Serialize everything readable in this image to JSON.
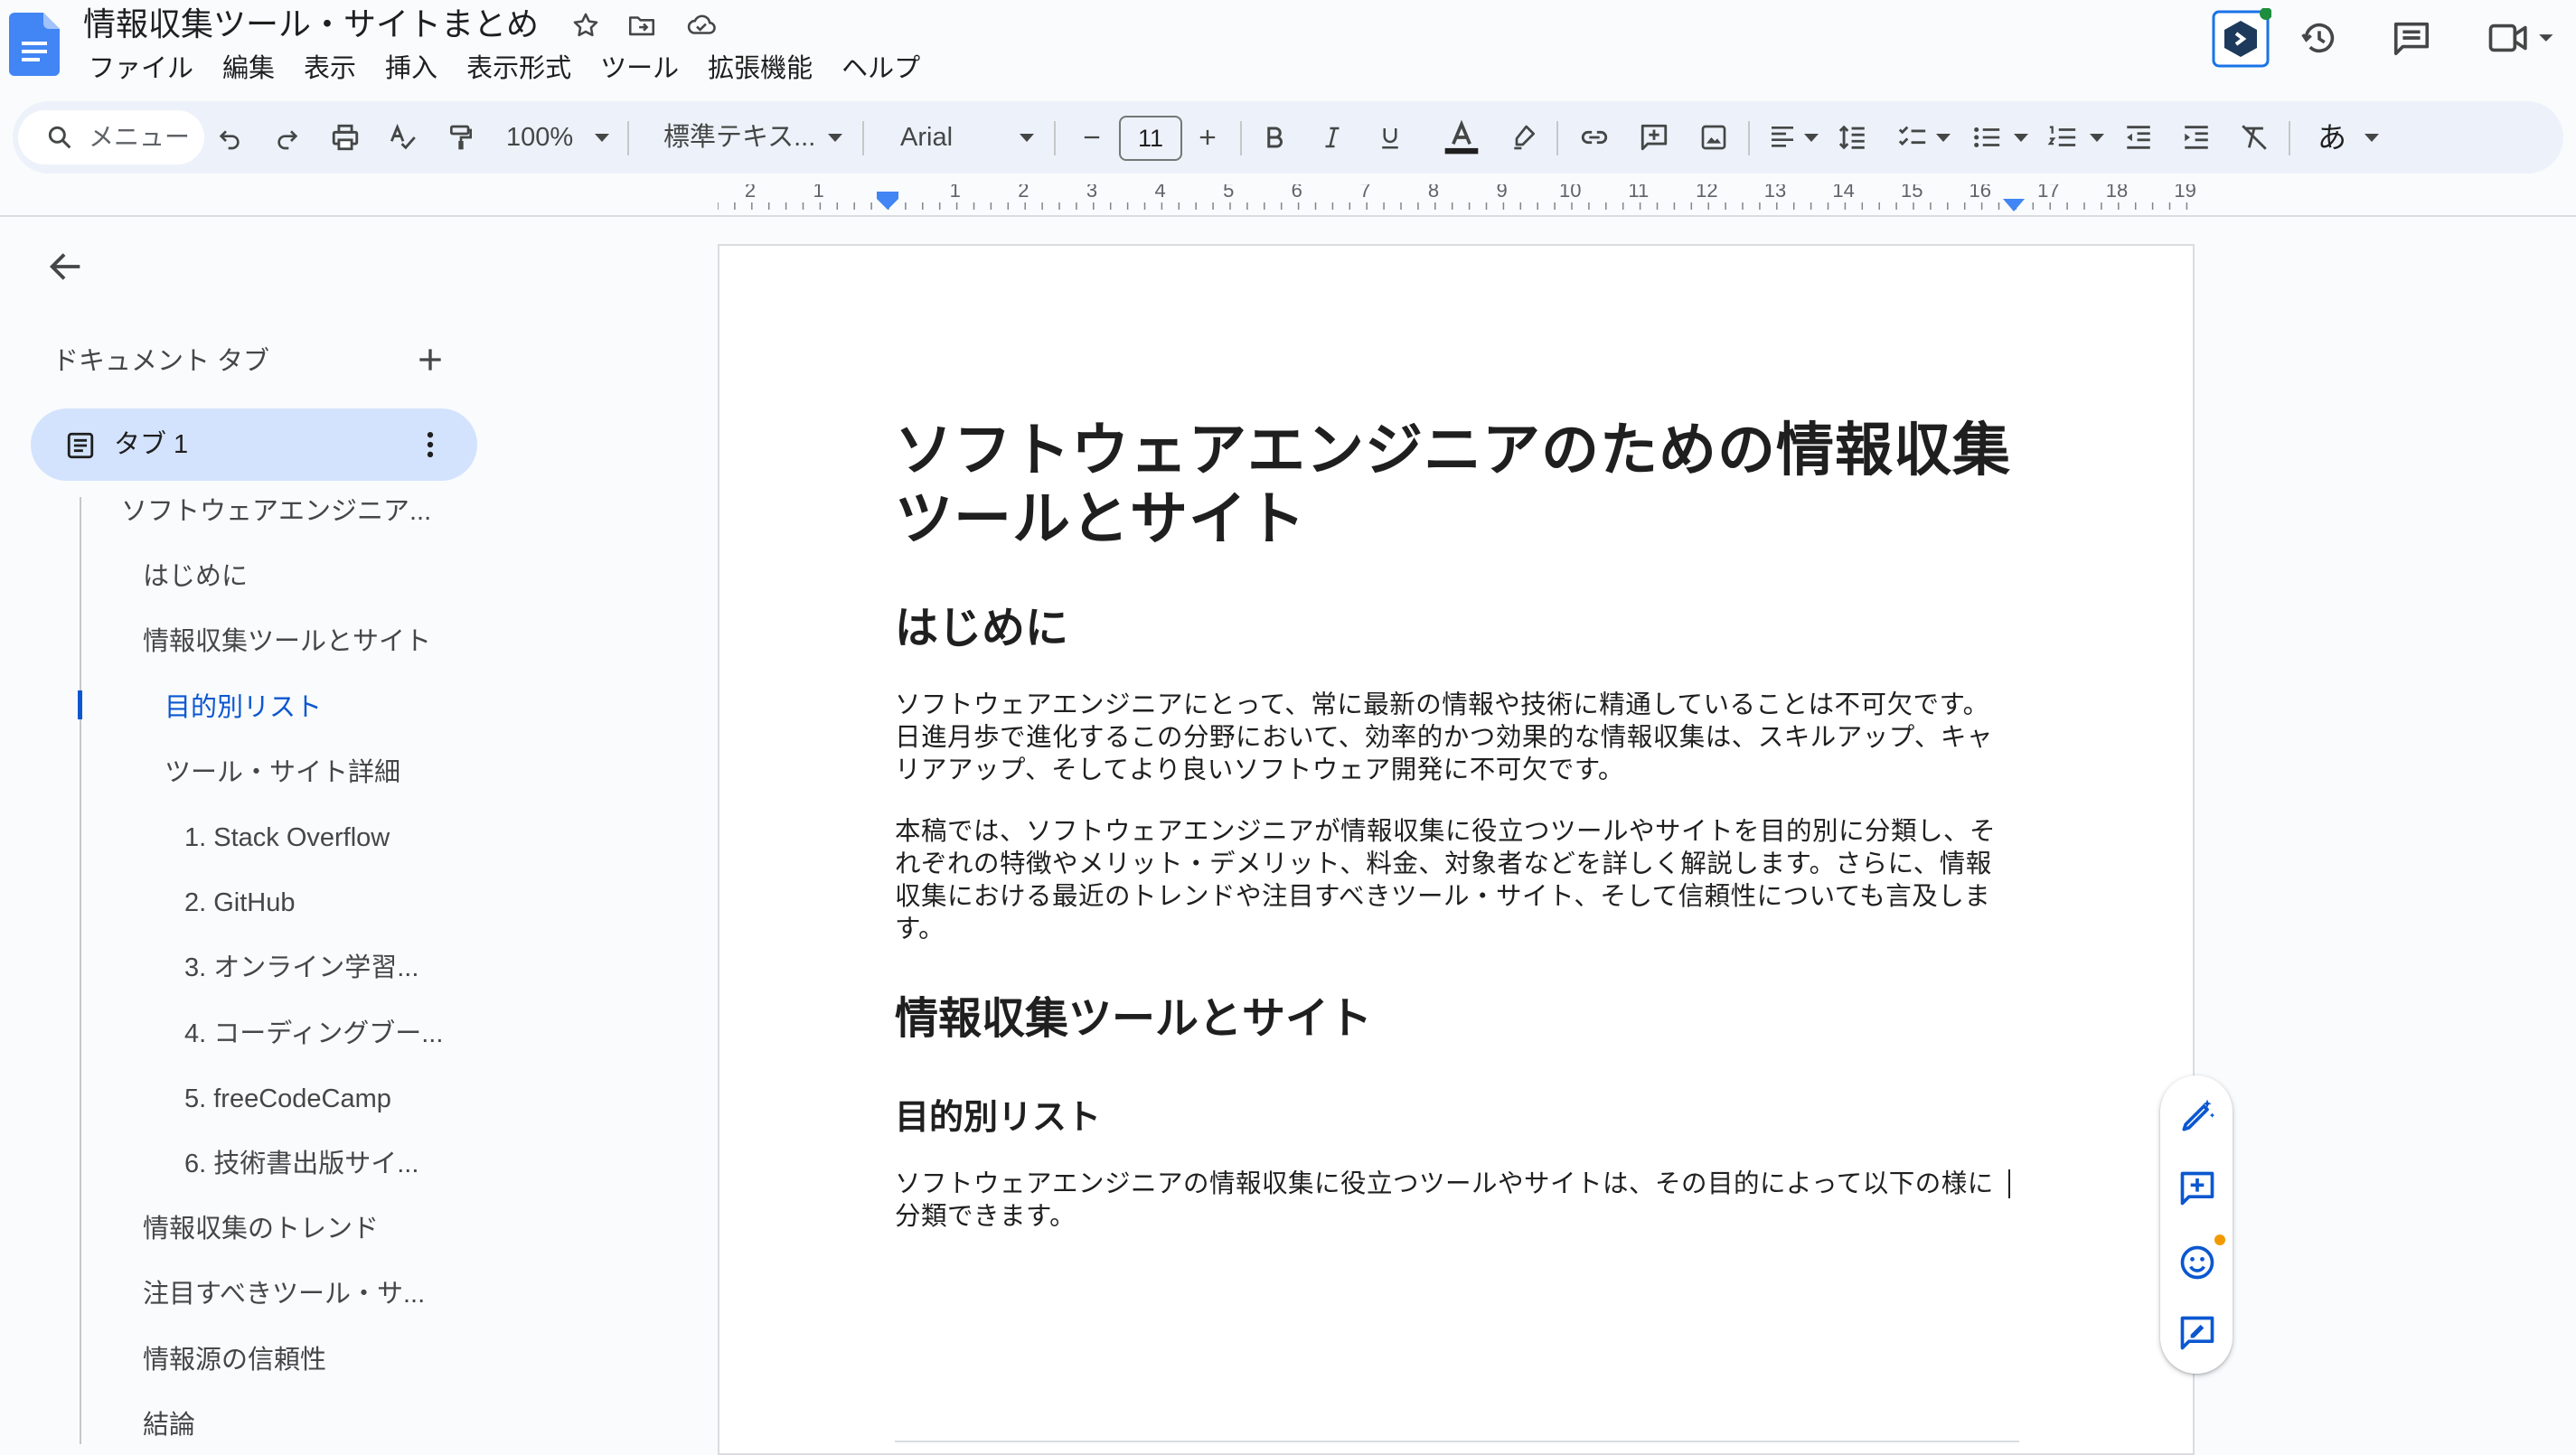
{
  "title_bar": {
    "document_title": "情報収集ツール・サイトまとめ",
    "star_icon": "star-icon",
    "move_icon": "folder-move-icon",
    "cloud_icon": "cloud-status-icon"
  },
  "menu": [
    "ファイル",
    "編集",
    "表示",
    "挿入",
    "表示形式",
    "ツール",
    "拡張機能",
    "ヘルプ"
  ],
  "toolbar": {
    "search_placeholder": "メニュー",
    "zoom": "100%",
    "paragraph_style": "標準テキス...",
    "font_family": "Arial",
    "font_size": "11",
    "input_tool_label": "あ"
  },
  "ruler": {
    "ticks": [
      "2",
      "1",
      "",
      "1",
      "2",
      "3",
      "4",
      "5",
      "6",
      "7",
      "8",
      "9",
      "10",
      "11",
      "12",
      "13",
      "14",
      "15",
      "16",
      "17",
      "18",
      "19"
    ]
  },
  "sidebar": {
    "heading": "ドキュメント タブ",
    "tab_label": "タブ 1",
    "outline": [
      {
        "label": "ソフトウェアエンジニア...",
        "level": 0
      },
      {
        "label": "はじめに",
        "level": 1
      },
      {
        "label": "情報収集ツールとサイト",
        "level": 1
      },
      {
        "label": "目的別リスト",
        "level": 2,
        "active": true
      },
      {
        "label": "ツール・サイト詳細",
        "level": 2
      },
      {
        "label": "1. Stack Overflow",
        "level": 3
      },
      {
        "label": "2. GitHub",
        "level": 3
      },
      {
        "label": "3. オンライン学習...",
        "level": 3
      },
      {
        "label": "4. コーディングブー...",
        "level": 3
      },
      {
        "label": "5. freeCodeCamp",
        "level": 3
      },
      {
        "label": "6. 技術書出版サイ...",
        "level": 3
      },
      {
        "label": "情報収集のトレンド",
        "level": 1
      },
      {
        "label": "注目すべきツール・サ...",
        "level": 1
      },
      {
        "label": "情報源の信頼性",
        "level": 1
      },
      {
        "label": "結論",
        "level": 1
      }
    ]
  },
  "document": {
    "title_line1": "ソフトウェアエンジニアのための情報収集",
    "title_line2": "ツールとサイト",
    "h_intro": "はじめに",
    "intro_p1_l1": "ソフトウェアエンジニアにとって、常に最新の情報や技術に精通していることは不可欠です。",
    "intro_p1_l2": "日進月歩で進化するこの分野において、効率的かつ効果的な情報収集は、スキルアップ、キャ",
    "intro_p1_l3": "リアアップ、そしてより良いソフトウェア開発に不可欠です。",
    "intro_p2_l1": "本稿では、ソフトウェアエンジニアが情報収集に役立つツールやサイトを目的別に分類し、そ",
    "intro_p2_l2": "れぞれの特徴やメリット・デメリット、料金、対象者などを詳しく解説します。さらに、情報",
    "intro_p2_l3": "収集における最近のトレンドや注目すべきツール・サイト、そして信頼性についても言及しま",
    "intro_p2_l4": "す。",
    "h_tools": "情報収集ツールとサイト",
    "h_purpose": "目的別リスト",
    "purpose_p_l1": "ソフトウェアエンジニアの情報収集に役立つツールやサイトは、その目的によって以下の様に",
    "purpose_p_l2": "分類できます。"
  },
  "colors": {
    "accent_blue": "#0b57d0",
    "tab_active_bg": "#d3e3fd",
    "toolbar_bg": "#edf2fa",
    "ruler_marker": "#4285f4"
  }
}
